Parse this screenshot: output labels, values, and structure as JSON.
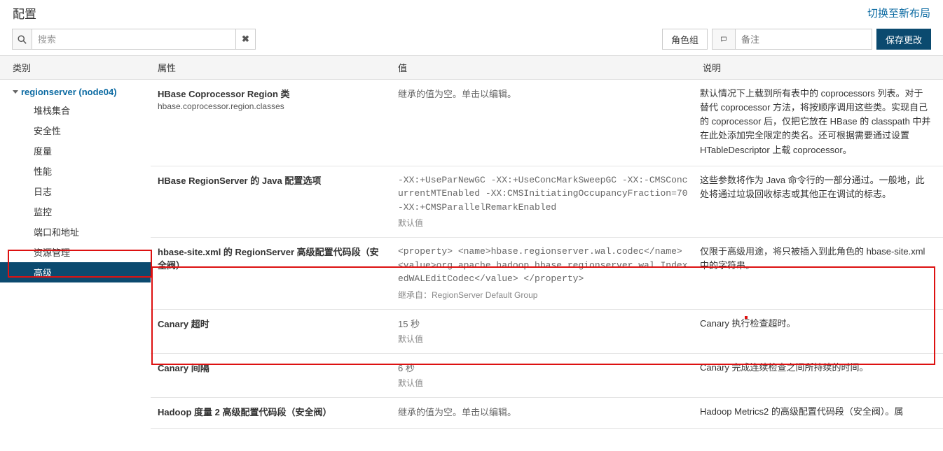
{
  "header": {
    "title": "配置",
    "switch_layout": "切换至新布局"
  },
  "toolbar": {
    "search_placeholder": "搜索",
    "role_group": "角色组",
    "comment_placeholder": "备注",
    "save": "保存更改"
  },
  "columns": {
    "category": "类别",
    "attribute": "属性",
    "value": "值",
    "description": "说明"
  },
  "sidebar": {
    "parent": "regionserver (node04)",
    "items": [
      {
        "label": "堆栈集合"
      },
      {
        "label": "安全性"
      },
      {
        "label": "度量"
      },
      {
        "label": "性能"
      },
      {
        "label": "日志"
      },
      {
        "label": "监控"
      },
      {
        "label": "端口和地址"
      },
      {
        "label": "资源管理"
      },
      {
        "label": "高级",
        "selected": true
      }
    ]
  },
  "rows": [
    {
      "title": "HBase Coprocessor Region 类",
      "sub": "hbase.coprocessor.region.classes",
      "value": "继承的值为空。单击以编辑。",
      "desc": "默认情况下上载到所有表中的 coprocessors 列表。对于替代 coprocessor 方法，将按顺序调用这些类。实现自己的 coprocessor 后，仅把它放在 HBase 的 classpath 中并在此处添加完全限定的类名。还可根据需要通过设置 HTableDescriptor 上载 coprocessor。"
    },
    {
      "title": "HBase RegionServer 的 Java 配置选项",
      "sub": "",
      "value_mono": "-XX:+UseParNewGC -XX:+UseConcMarkSweepGC -XX:-CMSConcurrentMTEnabled -XX:CMSInitiatingOccupancyFraction=70 -XX:+CMSParallelRemarkEnabled",
      "value_muted": "默认值",
      "desc": "这些参数将作为 Java 命令行的一部分通过。一般地，此处将通过垃圾回收标志或其他正在调试的标志。"
    },
    {
      "title": "hbase-site.xml 的 RegionServer 高级配置代码段（安全阀）",
      "sub": "",
      "value_mono": "<property> <name>hbase.regionserver.wal.codec</name> <value>org.apache.hadoop.hbase.regionserver.wal.IndexedWALEditCodec</value> </property>",
      "value_muted": "继承自：RegionServer Default Group",
      "desc": "仅限于高级用途，将只被插入到此角色的 hbase-site.xml 中的字符串。"
    },
    {
      "title": "Canary 超时",
      "sub": "",
      "value": "15 秒",
      "value_muted": "默认值",
      "desc": "Canary 执行检查超时。"
    },
    {
      "title": "Canary 间隔",
      "sub": "",
      "value": "6 秒",
      "value_muted": "默认值",
      "desc": "Canary 完成连续检查之间所持续的时间。"
    },
    {
      "title": "Hadoop 度量 2 高级配置代码段（安全阀）",
      "sub": "",
      "value": "继承的值为空。单击以编辑。",
      "desc": "Hadoop Metrics2 的高级配置代码段（安全阀）。属"
    }
  ]
}
